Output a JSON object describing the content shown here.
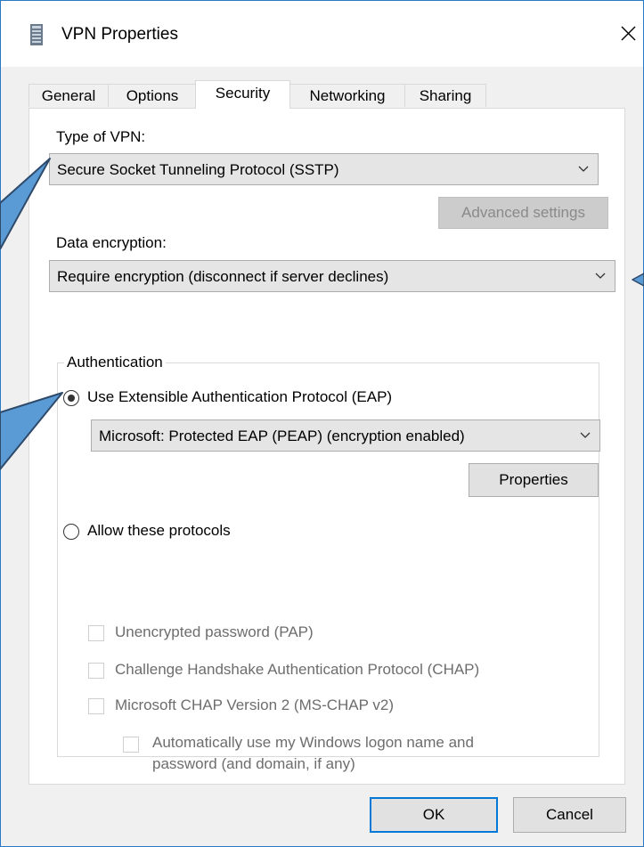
{
  "window": {
    "title": "VPN Properties"
  },
  "tabs": [
    {
      "label": "General"
    },
    {
      "label": "Options"
    },
    {
      "label": "Security"
    },
    {
      "label": "Networking"
    },
    {
      "label": "Sharing"
    }
  ],
  "security": {
    "vpn_type_label": "Type of VPN:",
    "vpn_type_value": "Secure Socket Tunneling Protocol (SSTP)",
    "advanced_button": "Advanced settings",
    "encryption_label": "Data encryption:",
    "encryption_value": "Require encryption (disconnect if server declines)",
    "authentication": {
      "group_title": "Authentication",
      "eap_radio": "Use Extensible Authentication Protocol (EAP)",
      "eap_value": "Microsoft: Protected EAP (PEAP) (encryption enabled)",
      "properties_button": "Properties",
      "protocols_radio": "Allow these protocols",
      "protocols": [
        {
          "label": "Unencrypted password (PAP)"
        },
        {
          "label": "Challenge Handshake Authentication Protocol (CHAP)"
        },
        {
          "label": "Microsoft CHAP Version 2 (MS-CHAP v2)"
        }
      ],
      "auto_logon_line1": "Automatically use my Windows logon name and",
      "auto_logon_line2": "password (and domain, if any)"
    }
  },
  "footer": {
    "ok_button": "OK",
    "cancel_button": "Cancel"
  },
  "colors": {
    "accent": "#0078d7",
    "callout_fill": "#5b9bd5",
    "callout_stroke": "#2e4a6b",
    "window_border": "#2b78c5"
  }
}
